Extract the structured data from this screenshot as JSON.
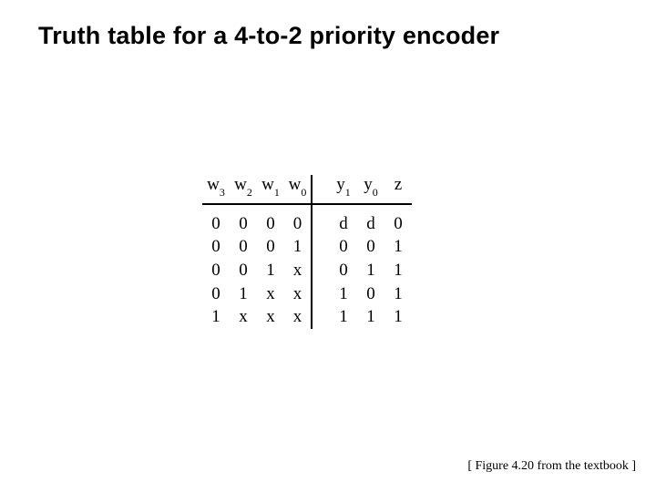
{
  "title": "Truth table for a 4-to-2 priority encoder",
  "headers": {
    "inputs": [
      {
        "base": "w",
        "sub": "3"
      },
      {
        "base": "w",
        "sub": "2"
      },
      {
        "base": "w",
        "sub": "1"
      },
      {
        "base": "w",
        "sub": "0"
      }
    ],
    "outputs": [
      {
        "base": "y",
        "sub": "1"
      },
      {
        "base": "y",
        "sub": "0"
      },
      {
        "base": "z",
        "sub": ""
      }
    ]
  },
  "rows": [
    {
      "in": [
        "0",
        "0",
        "0",
        "0"
      ],
      "out": [
        "d",
        "d",
        "0"
      ]
    },
    {
      "in": [
        "0",
        "0",
        "0",
        "1"
      ],
      "out": [
        "0",
        "0",
        "1"
      ]
    },
    {
      "in": [
        "0",
        "0",
        "1",
        "x"
      ],
      "out": [
        "0",
        "1",
        "1"
      ]
    },
    {
      "in": [
        "0",
        "1",
        "x",
        "x"
      ],
      "out": [
        "1",
        "0",
        "1"
      ]
    },
    {
      "in": [
        "1",
        "x",
        "x",
        "x"
      ],
      "out": [
        "1",
        "1",
        "1"
      ]
    }
  ],
  "footnote": "[ Figure 4.20 from the textbook ]",
  "chart_data": {
    "type": "table",
    "title": "Truth table for a 4-to-2 priority encoder",
    "columns": [
      "w3",
      "w2",
      "w1",
      "w0",
      "y1",
      "y0",
      "z"
    ],
    "rows": [
      [
        "0",
        "0",
        "0",
        "0",
        "d",
        "d",
        "0"
      ],
      [
        "0",
        "0",
        "0",
        "1",
        "0",
        "0",
        "1"
      ],
      [
        "0",
        "0",
        "1",
        "x",
        "0",
        "1",
        "1"
      ],
      [
        "0",
        "1",
        "x",
        "x",
        "1",
        "0",
        "1"
      ],
      [
        "1",
        "x",
        "x",
        "x",
        "1",
        "1",
        "1"
      ]
    ]
  }
}
